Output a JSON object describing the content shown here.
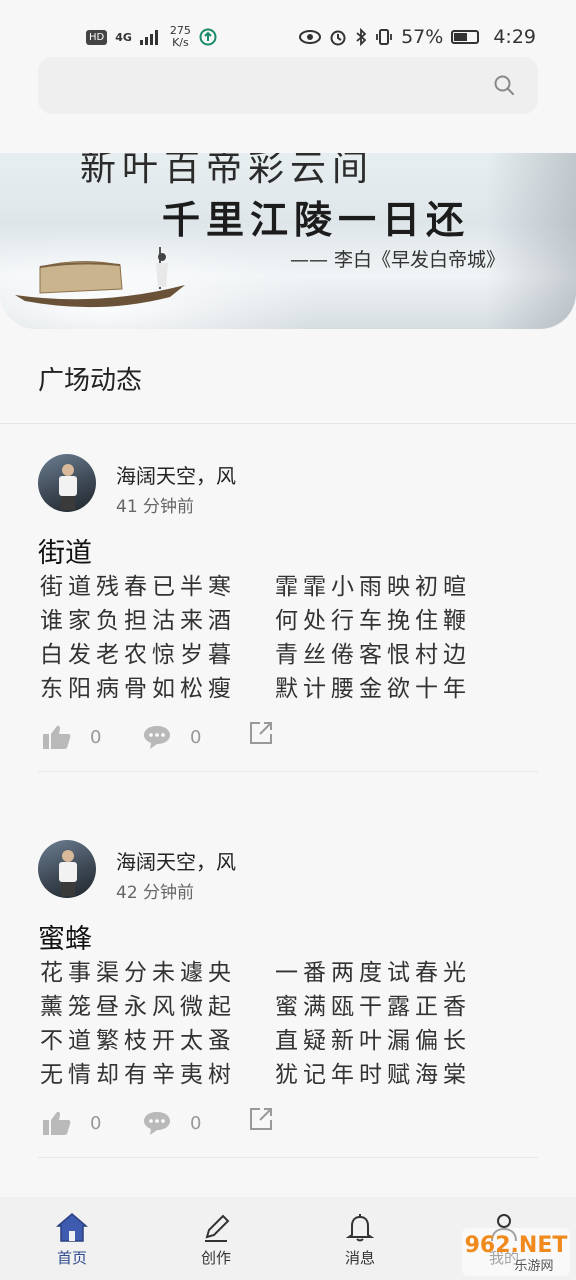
{
  "status_bar": {
    "hd": "HD",
    "signal": "4G",
    "speed_value": "275",
    "speed_unit": "K/s",
    "battery_percent": "57%",
    "battery_level": 0.57,
    "time": "4:29"
  },
  "search": {
    "icon": "search-icon"
  },
  "banner": {
    "line_top": "新叶百帝彩云间",
    "line_main": "千里江陵一日还",
    "attribution": "—— 李白《早发白帝城》"
  },
  "section": {
    "title": "广场动态"
  },
  "posts": [
    {
      "author": "海阔天空，风",
      "time": "41 分钟前",
      "title": "街道",
      "lines": [
        [
          "街道残春已半寒",
          "霏霏小雨映初暄"
        ],
        [
          "谁家负担沽来酒",
          "何处行车挽住鞭"
        ],
        [
          "白发老农惊岁暮",
          "青丝倦客恨村边"
        ],
        [
          "东阳病骨如松瘦",
          "默计腰金欲十年"
        ]
      ],
      "likes": "0",
      "comments": "0"
    },
    {
      "author": "海阔天空，风",
      "time": "42 分钟前",
      "title": "蜜蜂",
      "lines": [
        [
          "花事渠分未遽央",
          "一番两度试春光"
        ],
        [
          "薰笼昼永风微起",
          "蜜满瓯干露正香"
        ],
        [
          "不道繁枝开太蚤",
          "直疑新叶漏偏长"
        ],
        [
          "无情却有辛夷树",
          "犹记年时赋海棠"
        ]
      ],
      "likes": "0",
      "comments": "0"
    }
  ],
  "tabs": [
    {
      "label": "首页",
      "icon": "home-icon",
      "active": true
    },
    {
      "label": "创作",
      "icon": "pencil-icon",
      "active": false
    },
    {
      "label": "消息",
      "icon": "bell-icon",
      "active": false
    },
    {
      "label": "我的",
      "icon": "person-icon",
      "active": false
    }
  ],
  "watermark": {
    "brand": "962.NET",
    "subtitle": "乐游网"
  },
  "colors": {
    "accent": "#2f4a8f",
    "tab_active_icon": "#3f5bb0"
  }
}
